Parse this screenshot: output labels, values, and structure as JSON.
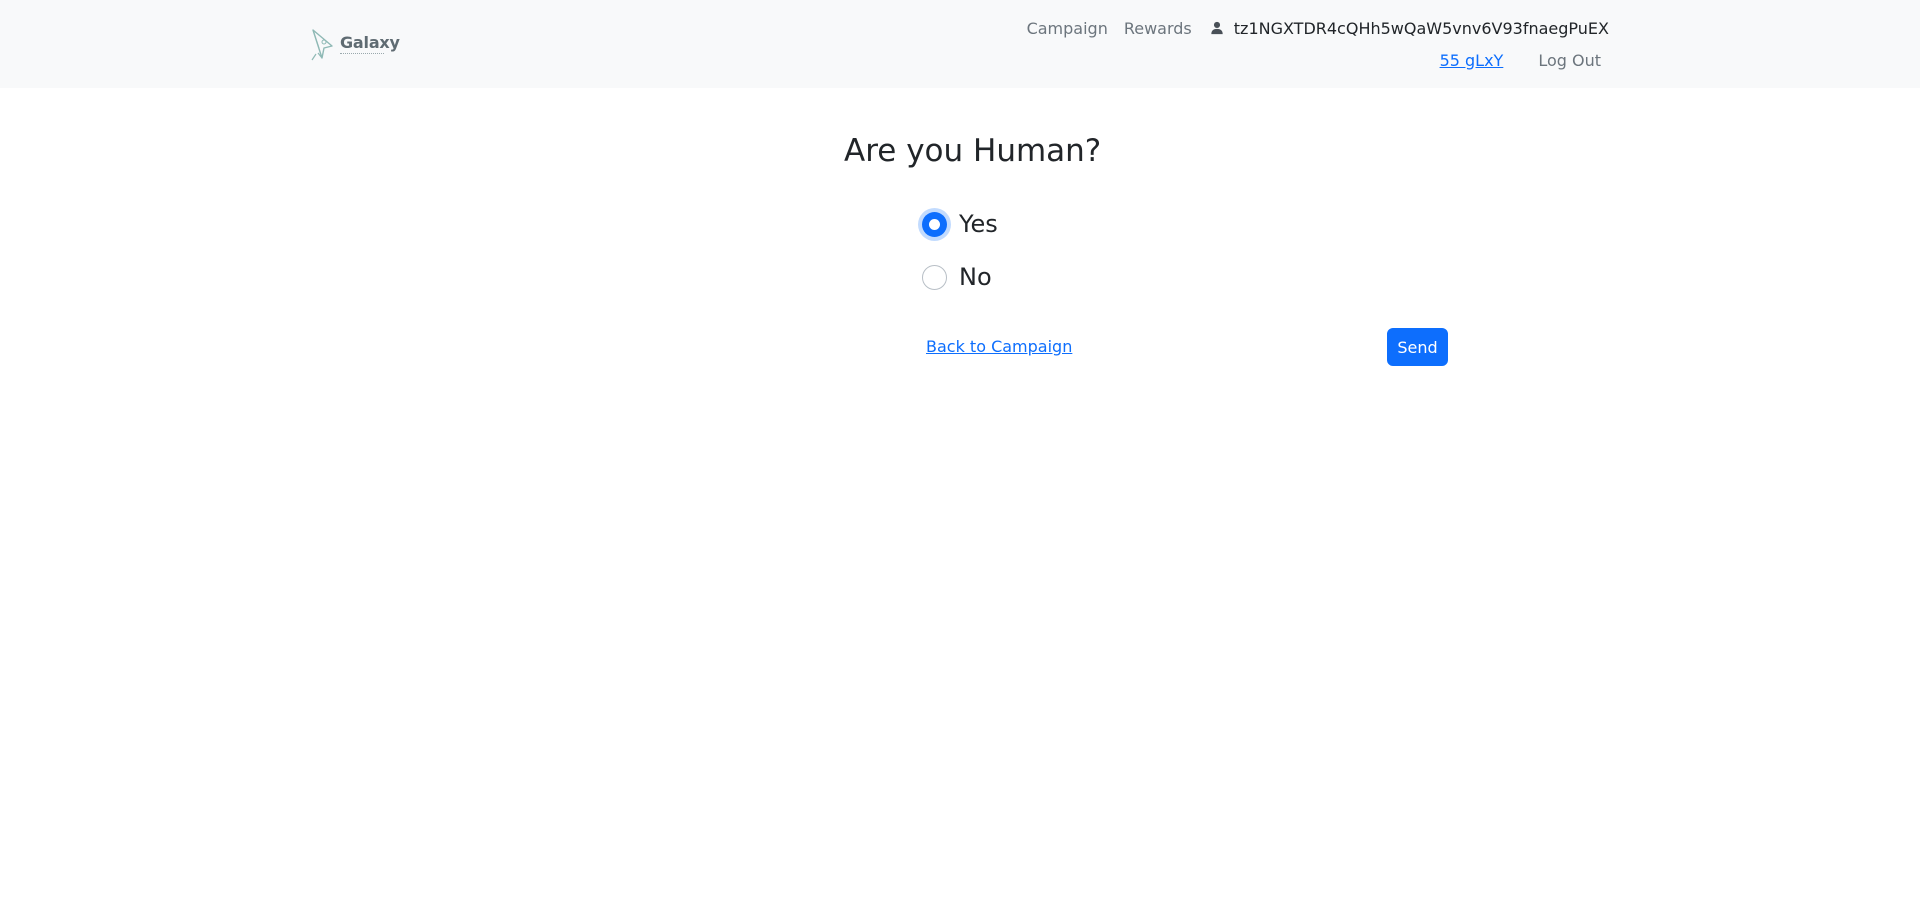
{
  "header": {
    "brand": {
      "name": "Galaxy",
      "icon": "rocket-icon"
    },
    "nav": {
      "campaign_label": "Campaign",
      "rewards_label": "Rewards",
      "user_icon": "person-icon",
      "user_address": "tz1NGXTDR4cQHh5wQaW5vnv6V93fnaegPuEX",
      "balance_label": "55 gLxY",
      "logout_label": "Log Out"
    }
  },
  "main": {
    "title": "Are you Human?",
    "options": [
      {
        "label": "Yes",
        "checked": true
      },
      {
        "label": "No",
        "checked": false
      }
    ],
    "back_link_label": "Back to Campaign",
    "send_label": "Send"
  },
  "colors": {
    "primary": "#0d6efd",
    "navbar_bg": "#f8f9fa",
    "muted_text": "#6c757d",
    "body_text": "#212529"
  }
}
